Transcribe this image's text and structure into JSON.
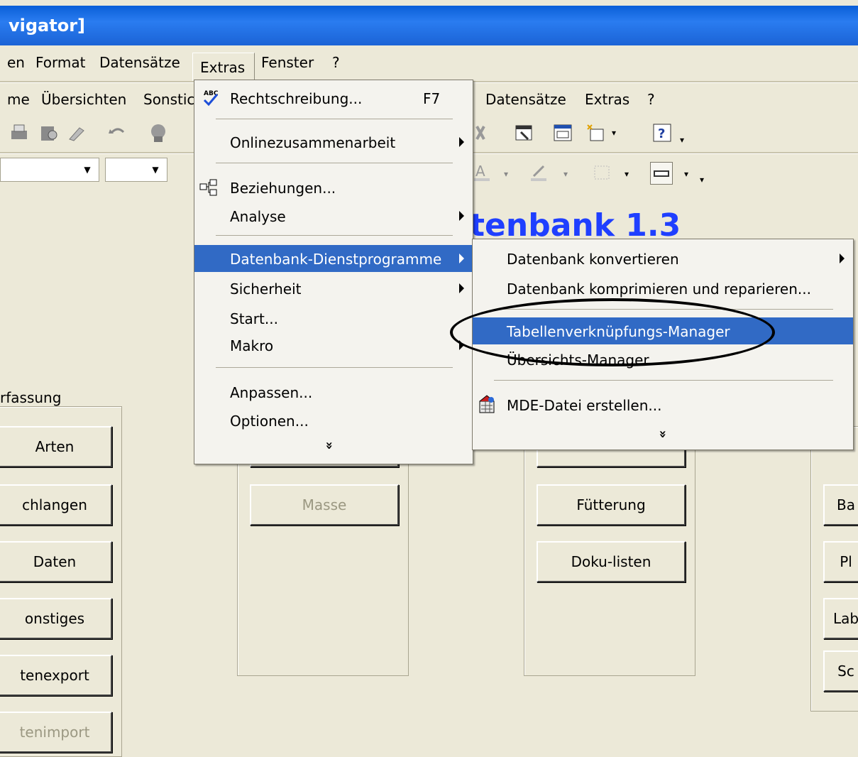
{
  "window": {
    "title": "vigator]"
  },
  "menubar": {
    "items": [
      "en",
      "Format",
      "Datensätze",
      "Extras",
      "Fenster",
      "?"
    ]
  },
  "menubar2": {
    "left_items": [
      "me",
      "Übersichten",
      "Sonstic"
    ],
    "right_items": [
      "Datensätze",
      "Extras",
      "?"
    ]
  },
  "form": {
    "title": "tenbank 1.3",
    "group1_label": "rfassung",
    "buttons_left": [
      "Arten",
      "chlangen",
      "Daten",
      "onstiges",
      "tenexport",
      "tenimport"
    ],
    "button_mid": "Masse",
    "buttons_right": [
      "Fütterung",
      "Doku-listen"
    ],
    "buttons_far_right": [
      "Ba",
      "Pl",
      "Lab",
      "Sc"
    ]
  },
  "extras_menu": {
    "items": [
      {
        "label": "Rechtschreibung...",
        "shortcut": "F7",
        "icon": "spellcheck-icon"
      },
      {
        "label": "Onlinezusammenarbeit",
        "submenu": true
      },
      {
        "label": "Beziehungen...",
        "icon": "relationships-icon"
      },
      {
        "label": "Analyse",
        "submenu": true
      },
      {
        "label": "Datenbank-Dienstprogramme",
        "submenu": true,
        "highlighted": true
      },
      {
        "label": "Sicherheit",
        "submenu": true
      },
      {
        "label": "Start..."
      },
      {
        "label": "Makro",
        "submenu": true
      },
      {
        "label": "Anpassen..."
      },
      {
        "label": "Optionen..."
      }
    ],
    "expand_glyph": "»"
  },
  "sub_menu": {
    "items": [
      {
        "label": "Datenbank konvertieren",
        "submenu": true
      },
      {
        "label": "Datenbank komprimieren und reparieren..."
      },
      {
        "label": "Tabellenverknüpfungs-Manager",
        "highlighted": true
      },
      {
        "label": "Übersichts-Manager"
      },
      {
        "label": "MDE-Datei erstellen...",
        "icon": "mde-file-icon"
      }
    ],
    "expand_glyph": "»"
  },
  "colors": {
    "title_bar": "#1b63d6",
    "highlight": "#316ac5",
    "form_title": "#1f3fff",
    "background": "#ece9d8"
  }
}
